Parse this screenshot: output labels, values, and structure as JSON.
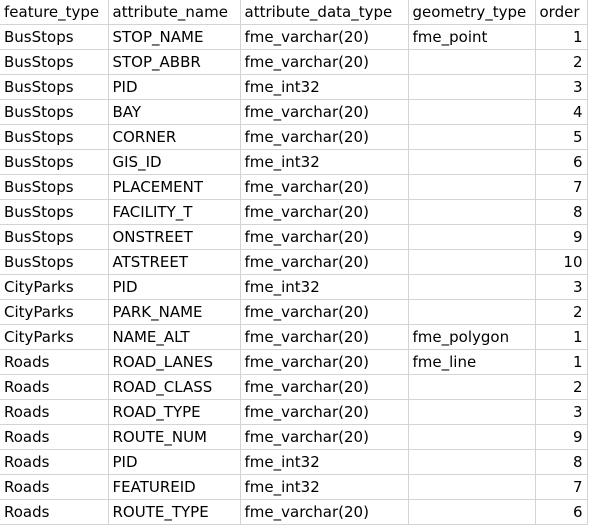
{
  "header": [
    "feature_type",
    "attribute_name",
    "attribute_data_type",
    "geometry_type",
    "order"
  ],
  "rows": [
    [
      "BusStops",
      "STOP_NAME",
      "fme_varchar(20)",
      "fme_point",
      "1"
    ],
    [
      "BusStops",
      "STOP_ABBR",
      "fme_varchar(20)",
      "",
      "2"
    ],
    [
      "BusStops",
      "PID",
      "fme_int32",
      "",
      "3"
    ],
    [
      "BusStops",
      "BAY",
      "fme_varchar(20)",
      "",
      "4"
    ],
    [
      "BusStops",
      "CORNER",
      "fme_varchar(20)",
      "",
      "5"
    ],
    [
      "BusStops",
      "GIS_ID",
      "fme_int32",
      "",
      "6"
    ],
    [
      "BusStops",
      "PLACEMENT",
      "fme_varchar(20)",
      "",
      "7"
    ],
    [
      "BusStops",
      "FACILITY_T",
      "fme_varchar(20)",
      "",
      "8"
    ],
    [
      "BusStops",
      "ONSTREET",
      "fme_varchar(20)",
      "",
      "9"
    ],
    [
      "BusStops",
      "ATSTREET",
      "fme_varchar(20)",
      "",
      "10"
    ],
    [
      "CityParks",
      "PID",
      "fme_int32",
      "",
      "3"
    ],
    [
      "CityParks",
      "PARK_NAME",
      "fme_varchar(20)",
      "",
      "2"
    ],
    [
      "CityParks",
      "NAME_ALT",
      "fme_varchar(20)",
      "fme_polygon",
      "1"
    ],
    [
      "Roads",
      "ROAD_LANES",
      "fme_varchar(20)",
      "fme_line",
      "1"
    ],
    [
      "Roads",
      "ROAD_CLASS",
      "fme_varchar(20)",
      "",
      "2"
    ],
    [
      "Roads",
      "ROAD_TYPE",
      "fme_varchar(20)",
      "",
      "3"
    ],
    [
      "Roads",
      "ROUTE_NUM",
      "fme_varchar(20)",
      "",
      "9"
    ],
    [
      "Roads",
      "PID",
      "fme_int32",
      "",
      "8"
    ],
    [
      "Roads",
      "FEATUREID",
      "fme_int32",
      "",
      "7"
    ],
    [
      "Roads",
      "ROUTE_TYPE",
      "fme_varchar(20)",
      "",
      "6"
    ]
  ]
}
